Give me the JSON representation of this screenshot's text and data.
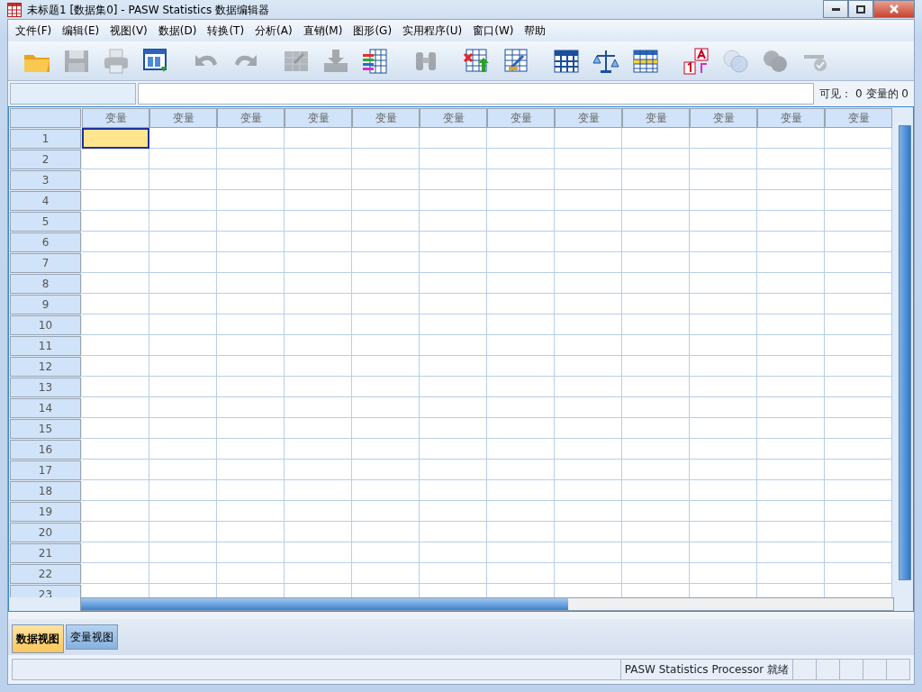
{
  "window": {
    "title": "未标题1 [数据集0] - PASW Statistics 数据编辑器"
  },
  "menu": [
    "文件(F)",
    "编辑(E)",
    "视图(V)",
    "数据(D)",
    "转换(T)",
    "分析(A)",
    "直销(M)",
    "图形(G)",
    "实用程序(U)",
    "窗口(W)",
    "帮助"
  ],
  "toolbar": [
    {
      "disabled": false
    },
    {
      "disabled": true
    },
    {
      "disabled": true
    },
    {
      "disabled": false
    },
    {
      "disabled": true
    },
    {
      "disabled": true
    },
    {
      "disabled": true
    },
    {
      "disabled": true
    },
    {
      "disabled": false
    },
    {
      "disabled": true
    },
    {
      "disabled": false
    },
    {
      "disabled": false
    },
    {
      "disabled": false
    },
    {
      "disabled": false
    },
    {
      "disabled": false
    },
    {
      "disabled": false
    },
    {
      "disabled": true
    },
    {
      "disabled": true
    },
    {
      "disabled": true
    }
  ],
  "visible_info": "可见： 0 变量的 0",
  "grid": {
    "columns": [
      "变量",
      "变量",
      "变量",
      "变量",
      "变量",
      "变量",
      "变量",
      "变量",
      "变量",
      "变量",
      "变量",
      "变量"
    ],
    "rows": [
      {
        "label": "1",
        "active": true
      },
      {
        "label": "2",
        "active": false
      },
      {
        "label": "3",
        "active": false
      },
      {
        "label": "4",
        "active": false
      },
      {
        "label": "5",
        "active": false
      },
      {
        "label": "6",
        "active": false
      },
      {
        "label": "7",
        "active": false
      },
      {
        "label": "8",
        "active": false
      },
      {
        "label": "9",
        "active": false
      },
      {
        "label": "10",
        "active": false
      },
      {
        "label": "11",
        "active": false
      },
      {
        "label": "12",
        "active": false
      },
      {
        "label": "13",
        "active": false
      },
      {
        "label": "14",
        "active": false
      },
      {
        "label": "15",
        "active": false
      },
      {
        "label": "16",
        "active": false
      },
      {
        "label": "17",
        "active": false
      },
      {
        "label": "18",
        "active": false
      },
      {
        "label": "19",
        "active": false
      },
      {
        "label": "20",
        "active": false
      },
      {
        "label": "21",
        "active": false
      },
      {
        "label": "22",
        "active": false
      },
      {
        "label": "23",
        "active": false
      }
    ]
  },
  "tabs": [
    {
      "label": "数据视图",
      "selected": true
    },
    {
      "label": "变量视图",
      "selected": false
    }
  ],
  "status_bar": {
    "text": "PASW Statistics Processor 就绪"
  }
}
